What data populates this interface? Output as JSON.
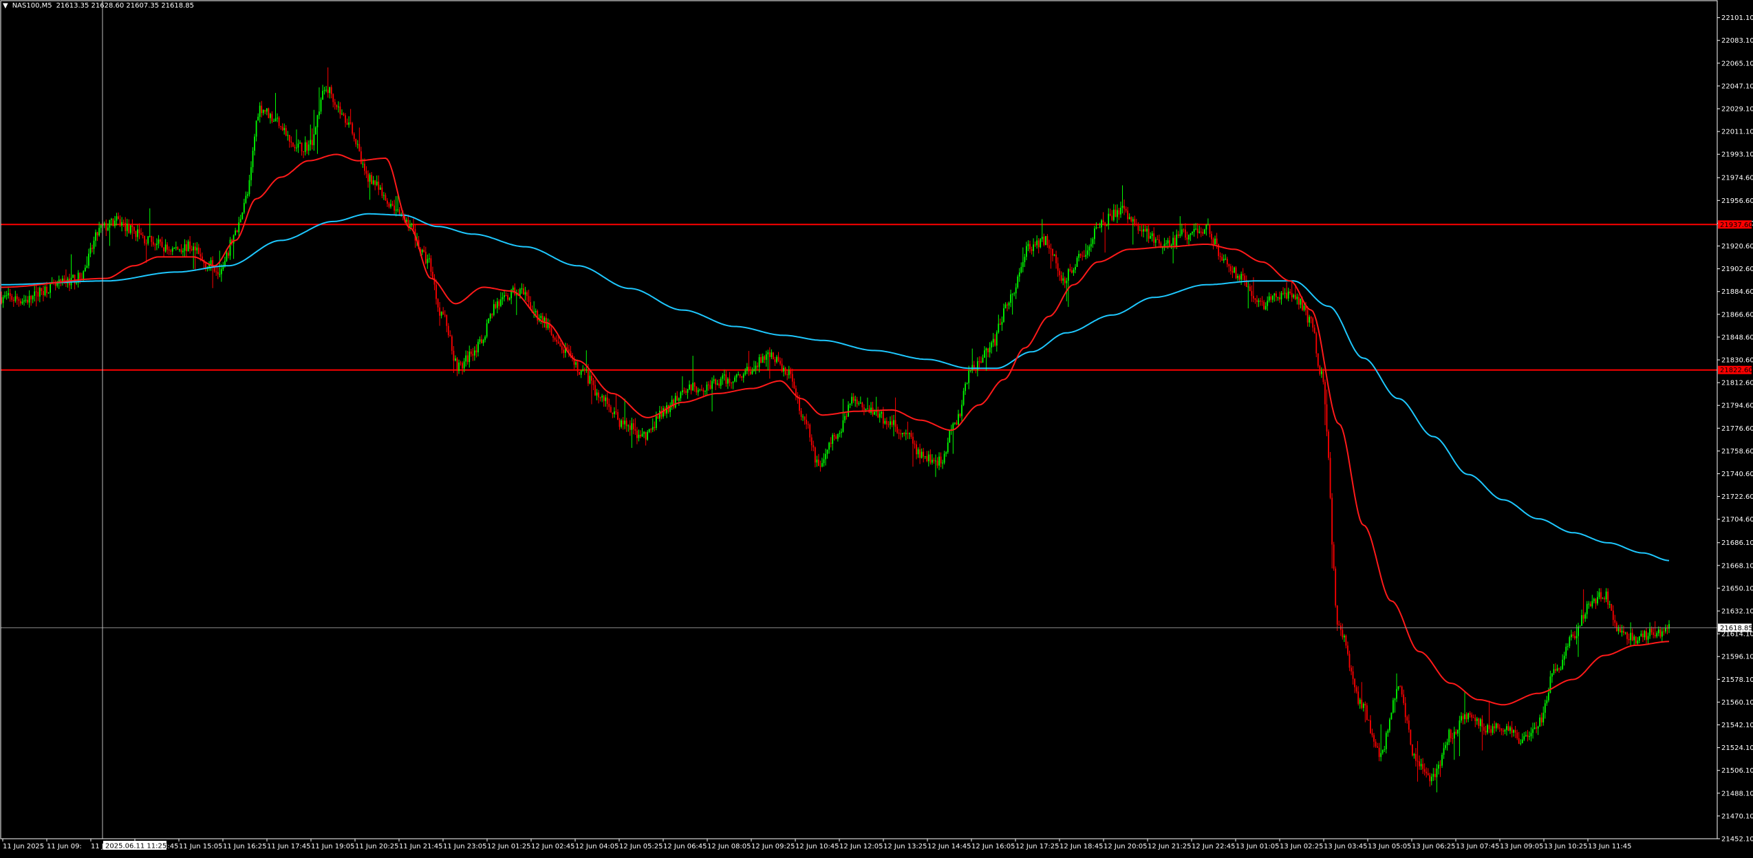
{
  "header": {
    "symbol_label": "NAS100,M5",
    "ohlc": "21613.35 21628.60 21607.35 21618.85"
  },
  "crosshair_time_label": "2025.06.11 11:25",
  "colors": {
    "background": "#000000",
    "frame": "#ffffff",
    "bull_candle": "#00ff00",
    "bear_candle": "#ff0000",
    "ma_fast": "#ff1a1a",
    "ma_slow": "#1ec8ff",
    "hline": "#ff0000",
    "bid_line": "#8c8c8c",
    "crosshair": "#bdbdbd",
    "axis_text": "#ffffff"
  },
  "chart_data": {
    "type": "candlestick",
    "symbol": "NAS100",
    "timeframe": "M5",
    "ylim": [
      21452.1,
      22114.5
    ],
    "y_ticks": [
      "22101.10",
      "22083.10",
      "22065.10",
      "22047.10",
      "22029.10",
      "22011.10",
      "21993.10",
      "21974.60",
      "21956.60",
      "21938.60",
      "21920.60",
      "21902.60",
      "21884.60",
      "21866.60",
      "21848.60",
      "21830.60",
      "21812.60",
      "21794.60",
      "21776.60",
      "21758.60",
      "21740.60",
      "21722.60",
      "21704.60",
      "21686.10",
      "21668.10",
      "21650.10",
      "21632.10",
      "21614.10",
      "21596.10",
      "21578.10",
      "21560.10",
      "21542.10",
      "21524.10",
      "21506.10",
      "21488.10",
      "21470.10",
      "21452.10"
    ],
    "x_ticks": [
      "11 Jun 2025",
      "11 Jun 09:",
      "11 Jun 12:25",
      "11 Jun 13:45",
      "11 Jun 15:05",
      "11 Jun 16:25",
      "11 Jun 17:45",
      "11 Jun 19:05",
      "11 Jun 20:25",
      "11 Jun 21:45",
      "11 Jun 23:05",
      "12 Jun 01:25",
      "12 Jun 02:45",
      "12 Jun 04:05",
      "12 Jun 05:25",
      "12 Jun 06:45",
      "12 Jun 08:05",
      "12 Jun 09:25",
      "12 Jun 10:45",
      "12 Jun 12:05",
      "12 Jun 13:25",
      "12 Jun 14:45",
      "12 Jun 16:05",
      "12 Jun 17:25",
      "12 Jun 18:45",
      "12 Jun 20:05",
      "12 Jun 21:25",
      "12 Jun 22:45",
      "13 Jun 01:05",
      "13 Jun 02:25",
      "13 Jun 03:45",
      "13 Jun 05:05",
      "13 Jun 06:25",
      "13 Jun 07:45",
      "13 Jun 09:05",
      "13 Jun 10:25",
      "13 Jun 11:45"
    ],
    "horizontal_lines": [
      {
        "price": 21937.6,
        "label": "21937.60"
      },
      {
        "price": 21822.6,
        "label": "21822.60"
      }
    ],
    "current_price": {
      "price": 21618.85,
      "label": "21618.85"
    },
    "price_anchors": [
      [
        0,
        21880
      ],
      [
        14,
        21878
      ],
      [
        28,
        21888
      ],
      [
        44,
        21895
      ],
      [
        58,
        21935
      ],
      [
        66,
        21940
      ],
      [
        76,
        21932
      ],
      [
        84,
        21925
      ],
      [
        96,
        21918
      ],
      [
        108,
        21920
      ],
      [
        118,
        21906
      ],
      [
        126,
        21902
      ],
      [
        134,
        21930
      ],
      [
        140,
        21958
      ],
      [
        148,
        22030
      ],
      [
        158,
        22020
      ],
      [
        168,
        21998
      ],
      [
        176,
        22000
      ],
      [
        186,
        22045
      ],
      [
        198,
        22020
      ],
      [
        210,
        21975
      ],
      [
        222,
        21955
      ],
      [
        232,
        21940
      ],
      [
        244,
        21910
      ],
      [
        252,
        21868
      ],
      [
        262,
        21825
      ],
      [
        272,
        21840
      ],
      [
        284,
        21875
      ],
      [
        296,
        21885
      ],
      [
        308,
        21865
      ],
      [
        320,
        21840
      ],
      [
        332,
        21822
      ],
      [
        344,
        21800
      ],
      [
        356,
        21780
      ],
      [
        368,
        21770
      ],
      [
        380,
        21790
      ],
      [
        392,
        21808
      ],
      [
        404,
        21810
      ],
      [
        416,
        21815
      ],
      [
        428,
        21822
      ],
      [
        440,
        21835
      ],
      [
        452,
        21818
      ],
      [
        460,
        21780
      ],
      [
        468,
        21748
      ],
      [
        478,
        21770
      ],
      [
        488,
        21800
      ],
      [
        498,
        21792
      ],
      [
        508,
        21782
      ],
      [
        518,
        21770
      ],
      [
        528,
        21755
      ],
      [
        538,
        21750
      ],
      [
        546,
        21780
      ],
      [
        556,
        21825
      ],
      [
        566,
        21840
      ],
      [
        578,
        21880
      ],
      [
        588,
        21920
      ],
      [
        598,
        21925
      ],
      [
        608,
        21895
      ],
      [
        618,
        21912
      ],
      [
        630,
        21940
      ],
      [
        642,
        21948
      ],
      [
        654,
        21932
      ],
      [
        666,
        21920
      ],
      [
        678,
        21930
      ],
      [
        690,
        21935
      ],
      [
        700,
        21910
      ],
      [
        710,
        21895
      ],
      [
        722,
        21875
      ],
      [
        734,
        21882
      ],
      [
        742,
        21878
      ],
      [
        750,
        21860
      ],
      [
        756,
        21820
      ],
      [
        766,
        21618
      ],
      [
        778,
        21560
      ],
      [
        790,
        21520
      ],
      [
        800,
        21572
      ],
      [
        810,
        21515
      ],
      [
        820,
        21500
      ],
      [
        830,
        21535
      ],
      [
        840,
        21550
      ],
      [
        850,
        21540
      ],
      [
        860,
        21540
      ],
      [
        870,
        21530
      ],
      [
        880,
        21544
      ],
      [
        890,
        21585
      ],
      [
        900,
        21610
      ],
      [
        910,
        21640
      ],
      [
        918,
        21645
      ],
      [
        926,
        21615
      ],
      [
        936,
        21610
      ],
      [
        946,
        21615
      ],
      [
        955,
        21618
      ]
    ],
    "ma_fast_anchors": [
      [
        0,
        21888
      ],
      [
        60,
        21895
      ],
      [
        76,
        21905
      ],
      [
        90,
        21912
      ],
      [
        110,
        21912
      ],
      [
        122,
        21905
      ],
      [
        134,
        21925
      ],
      [
        146,
        21958
      ],
      [
        160,
        21975
      ],
      [
        176,
        21988
      ],
      [
        192,
        21993
      ],
      [
        204,
        21988
      ],
      [
        220,
        21990
      ],
      [
        234,
        21935
      ],
      [
        246,
        21895
      ],
      [
        260,
        21875
      ],
      [
        276,
        21888
      ],
      [
        292,
        21885
      ],
      [
        312,
        21860
      ],
      [
        330,
        21830
      ],
      [
        350,
        21804
      ],
      [
        370,
        21785
      ],
      [
        390,
        21797
      ],
      [
        410,
        21804
      ],
      [
        430,
        21808
      ],
      [
        446,
        21814
      ],
      [
        458,
        21800
      ],
      [
        470,
        21787
      ],
      [
        490,
        21790
      ],
      [
        510,
        21791
      ],
      [
        526,
        21783
      ],
      [
        544,
        21775
      ],
      [
        560,
        21795
      ],
      [
        574,
        21815
      ],
      [
        586,
        21840
      ],
      [
        600,
        21865
      ],
      [
        614,
        21890
      ],
      [
        628,
        21908
      ],
      [
        646,
        21918
      ],
      [
        668,
        21920
      ],
      [
        690,
        21922
      ],
      [
        706,
        21918
      ],
      [
        722,
        21908
      ],
      [
        738,
        21893
      ],
      [
        750,
        21870
      ],
      [
        766,
        21780
      ],
      [
        780,
        21700
      ],
      [
        796,
        21640
      ],
      [
        812,
        21600
      ],
      [
        830,
        21575
      ],
      [
        846,
        21562
      ],
      [
        860,
        21558
      ],
      [
        880,
        21567
      ],
      [
        900,
        21578
      ],
      [
        918,
        21597
      ],
      [
        936,
        21605
      ],
      [
        955,
        21608
      ]
    ],
    "ma_slow_anchors": [
      [
        0,
        21890
      ],
      [
        60,
        21893
      ],
      [
        100,
        21900
      ],
      [
        130,
        21905
      ],
      [
        160,
        21925
      ],
      [
        190,
        21940
      ],
      [
        210,
        21946
      ],
      [
        230,
        21945
      ],
      [
        250,
        21936
      ],
      [
        270,
        21930
      ],
      [
        300,
        21920
      ],
      [
        330,
        21905
      ],
      [
        360,
        21887
      ],
      [
        390,
        21870
      ],
      [
        420,
        21857
      ],
      [
        448,
        21850
      ],
      [
        470,
        21846
      ],
      [
        500,
        21838
      ],
      [
        530,
        21831
      ],
      [
        554,
        21824
      ],
      [
        570,
        21824
      ],
      [
        590,
        21837
      ],
      [
        610,
        21852
      ],
      [
        636,
        21866
      ],
      [
        660,
        21880
      ],
      [
        690,
        21890
      ],
      [
        718,
        21893
      ],
      [
        740,
        21893
      ],
      [
        760,
        21873
      ],
      [
        780,
        21832
      ],
      [
        800,
        21800
      ],
      [
        820,
        21770
      ],
      [
        840,
        21740
      ],
      [
        860,
        21720
      ],
      [
        880,
        21705
      ],
      [
        900,
        21694
      ],
      [
        920,
        21686
      ],
      [
        940,
        21678
      ],
      [
        955,
        21672
      ]
    ]
  }
}
